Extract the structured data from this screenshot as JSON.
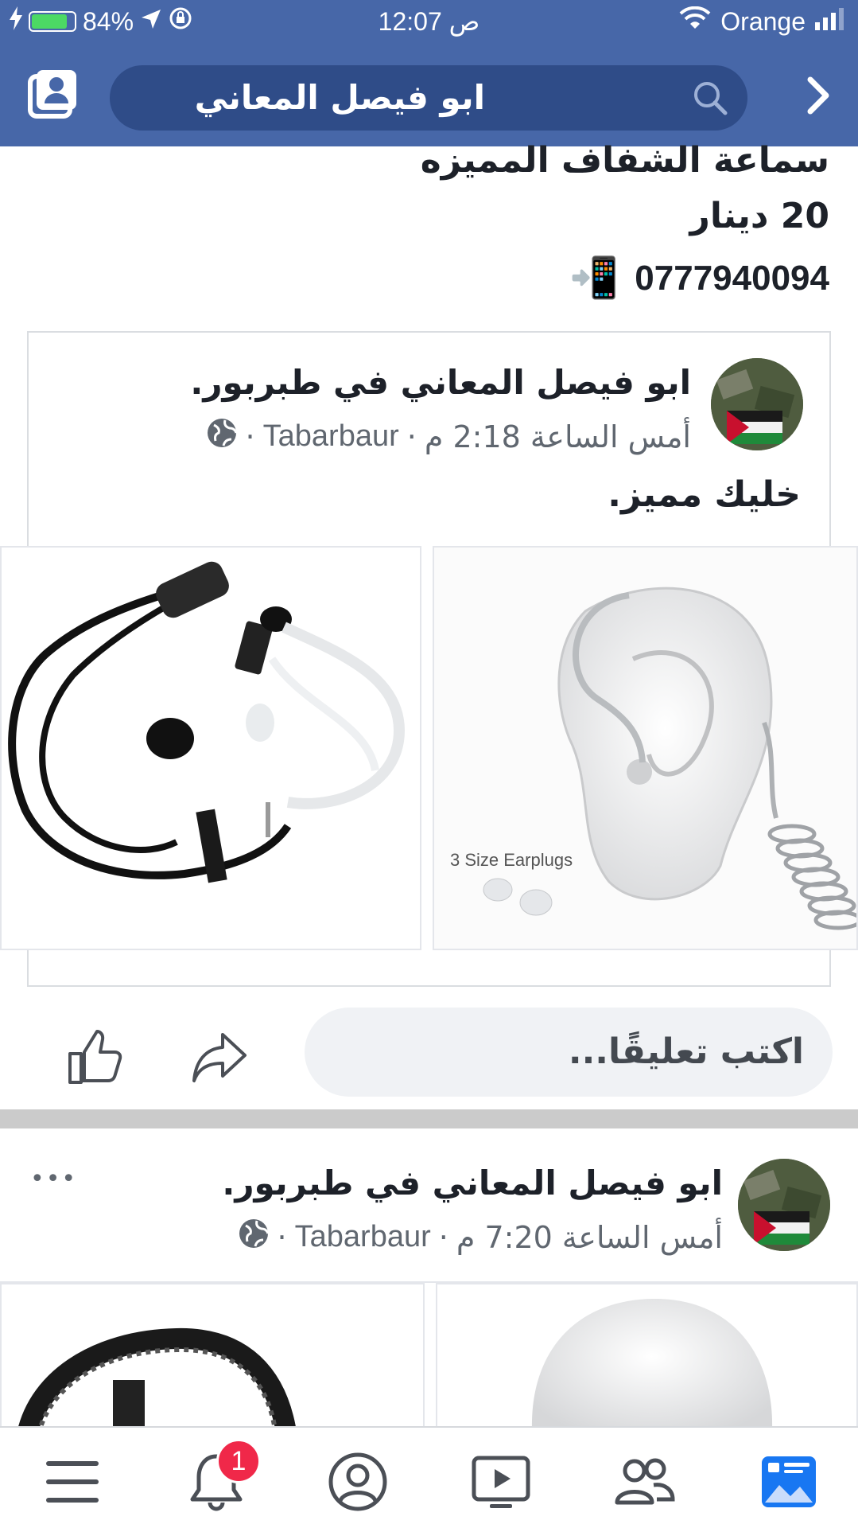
{
  "status_bar": {
    "battery_percent": "84%",
    "battery_level": 0.84,
    "time": "12:07 ص",
    "carrier": "Orange"
  },
  "nav": {
    "search_text": "ابو فيصل المعاني"
  },
  "previous_post": {
    "line1": "سماعة الشفاف المميزه",
    "line2": "20 دينار",
    "phone": "0777940094",
    "phone_emoji": "📲"
  },
  "post1": {
    "author": "ابو فيصل المعاني في طبربور.",
    "time": "أمس الساعة 2:18 م",
    "place": "Tabarbaur",
    "separator": "·",
    "caption": "خليك مميز.",
    "photo2_label": "3 Size Earplugs"
  },
  "actions": {
    "comment_placeholder": "اكتب تعليقًا..."
  },
  "post2": {
    "author": "ابو فيصل المعاني في طبربور.",
    "time": "أمس الساعة 7:20 م",
    "place": "Tabarbaur",
    "separator": "·",
    "more": "•••"
  },
  "tabbar": {
    "notification_count": "1"
  },
  "colors": {
    "brand": "#4767a8",
    "search_bg": "#2f4c88",
    "badge": "#f02849",
    "battery": "#4cd964",
    "active_tab": "#1877f2"
  }
}
